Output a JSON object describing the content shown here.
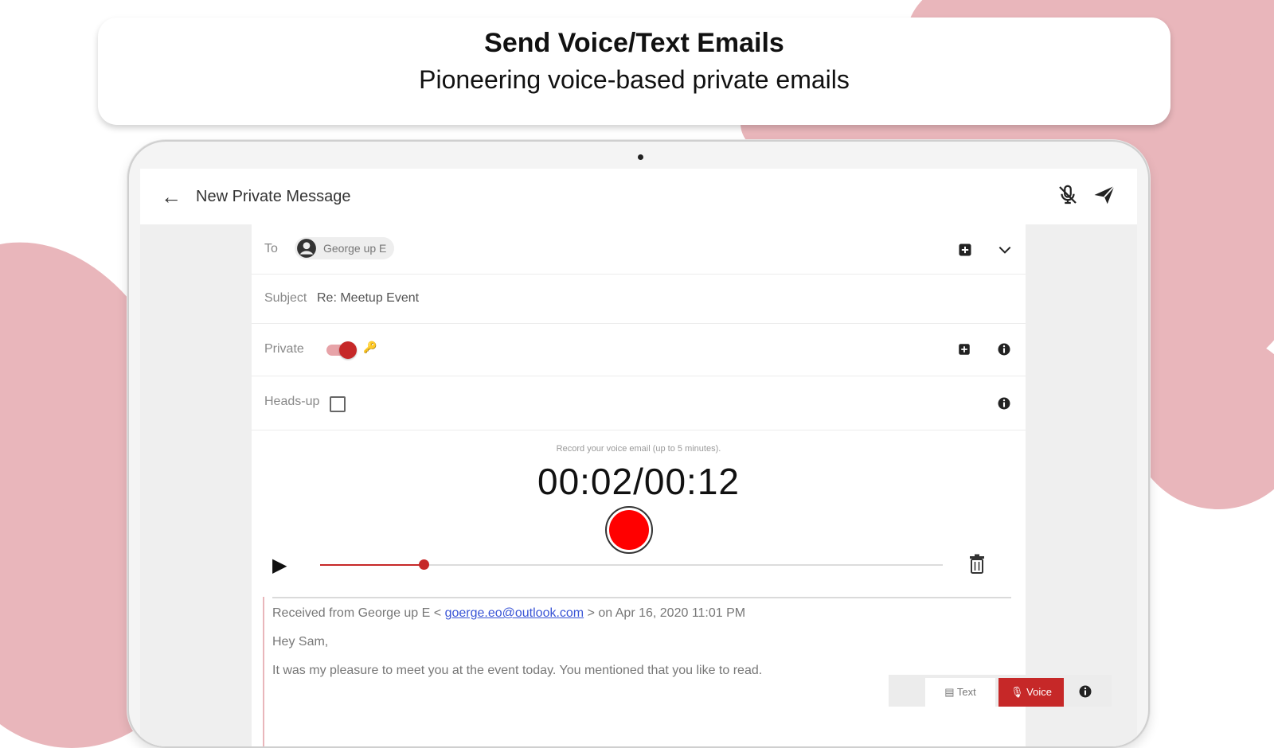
{
  "banner": {
    "title": "Send Voice/Text Emails",
    "subtitle": "Pioneering voice-based private emails"
  },
  "appbar": {
    "title": "New Private Message",
    "icons": [
      "back-arrow-icon",
      "mic-off-icon",
      "send-icon"
    ]
  },
  "form": {
    "to": {
      "label": "To",
      "recipient": "George up E"
    },
    "subject": {
      "label": "Subject",
      "value": "Re: Meetup Event"
    },
    "private": {
      "label": "Private",
      "enabled": true
    },
    "headsup": {
      "label": "Heads-up",
      "checked": false
    }
  },
  "recorder": {
    "hint": "Record your voice email (up to 5 minutes).",
    "timer": "00:02/00:12",
    "progress": 0.166
  },
  "quote": {
    "meta_prefix": "Received from George up E <",
    "email": "goerge.eo@outlook.com",
    "meta_suffix": "> on Apr 16, 2020 11:01 PM",
    "greeting": "Hey Sam,",
    "body": "It was my pleasure to meet you at the event today. You mentioned that you like to read."
  },
  "mode": {
    "text_label": "Text",
    "voice_label": "Voice",
    "selected": "Voice"
  },
  "colors": {
    "accent": "#c62828",
    "record": "#ff0000",
    "blob": "#e9b6bb",
    "link": "#3a55d6"
  }
}
